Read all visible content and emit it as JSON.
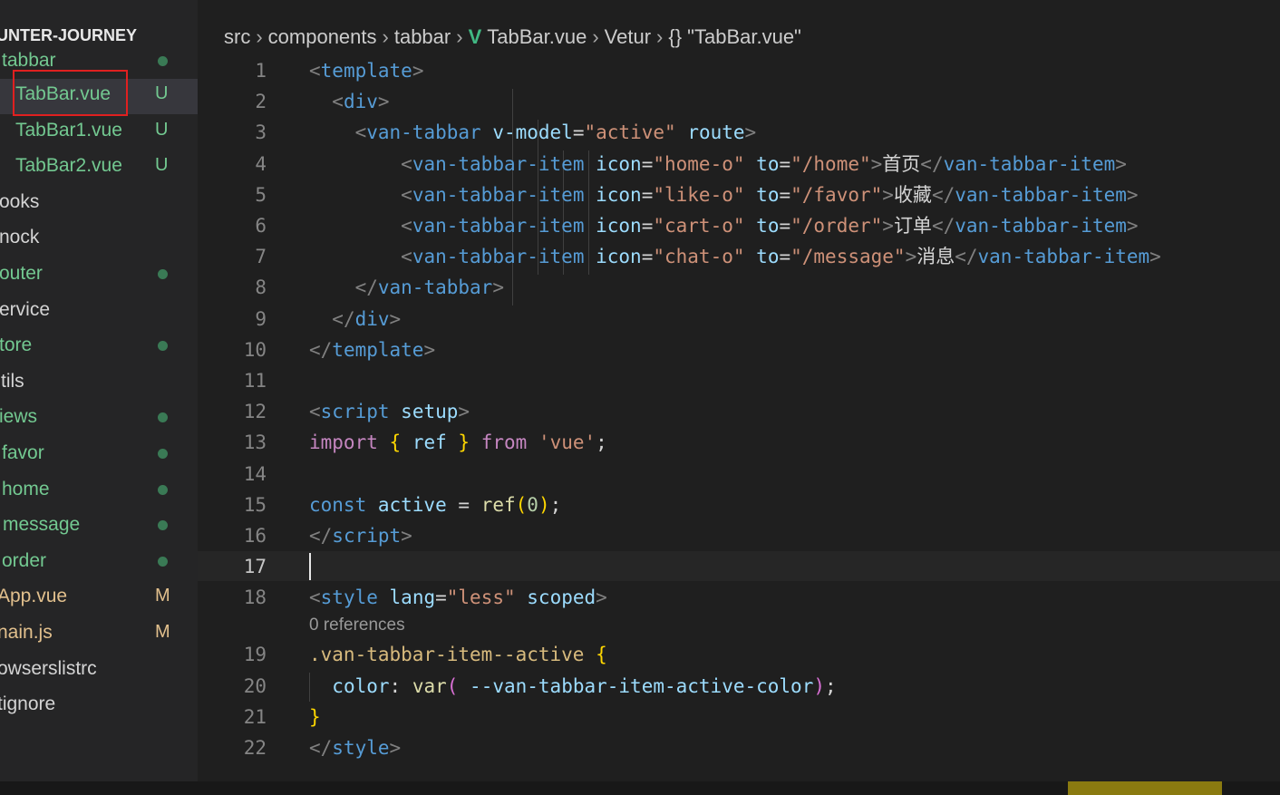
{
  "sidebar": {
    "header": "UNTER-JOURNEY",
    "items": [
      {
        "label": "tabbar",
        "status": "dot",
        "color": "green"
      },
      {
        "label": "TabBar.vue",
        "status": "U",
        "color": "green",
        "selected": true
      },
      {
        "label": "TabBar1.vue",
        "status": "U",
        "color": "green"
      },
      {
        "label": "TabBar2.vue",
        "status": "U",
        "color": "green"
      },
      {
        "label": "ooks",
        "status": "",
        "color": "white"
      },
      {
        "label": "nock",
        "status": "",
        "color": "white"
      },
      {
        "label": "outer",
        "status": "dot",
        "color": "green"
      },
      {
        "label": "ervice",
        "status": "",
        "color": "white"
      },
      {
        "label": "tore",
        "status": "dot",
        "color": "green"
      },
      {
        "label": "tils",
        "status": "",
        "color": "white"
      },
      {
        "label": "iews",
        "status": "dot",
        "color": "green"
      },
      {
        "label": "favor",
        "status": "dot",
        "color": "green"
      },
      {
        "label": "home",
        "status": "dot",
        "color": "green"
      },
      {
        "label": "message",
        "status": "dot",
        "color": "green"
      },
      {
        "label": "order",
        "status": "dot",
        "color": "green"
      },
      {
        "label": "App.vue",
        "status": "M",
        "color": "mod"
      },
      {
        "label": "nain.js",
        "status": "M",
        "color": "mod"
      },
      {
        "label": "owserslistrc",
        "status": "",
        "color": "white"
      },
      {
        "label": "tignore",
        "status": "",
        "color": "white"
      }
    ]
  },
  "breadcrumb": {
    "parts": [
      "src",
      "components",
      "tabbar"
    ],
    "file": "TabBar.vue",
    "extension": "Vetur",
    "symbol": "\"TabBar.vue\""
  },
  "editor": {
    "line_numbers": [
      "1",
      "2",
      "3",
      "4",
      "5",
      "6",
      "7",
      "8",
      "9",
      "10",
      "11",
      "12",
      "13",
      "14",
      "15",
      "16",
      "17",
      "18",
      "19",
      "20",
      "21",
      "22"
    ],
    "active_line": "17",
    "codelens": "0 references",
    "code": {
      "l1": {
        "a": "<",
        "b": "template",
        "c": ">"
      },
      "l2": {
        "a": "<",
        "b": "div",
        "c": ">"
      },
      "l3": {
        "a": "<",
        "b": "van-tabbar",
        "c": " ",
        "d": "v-model",
        "e": "=",
        "f": "\"active\"",
        "g": " ",
        "h": "route",
        "i": ">"
      },
      "l4": {
        "a": "<",
        "b": "van-tabbar-item",
        "c": " ",
        "d": "icon",
        "e": "=",
        "f": "\"home-o\"",
        "g": " ",
        "h": "to",
        "i": "=",
        "j": "\"/home\"",
        "k": ">",
        "l": "首页",
        "m": "</",
        "n": "van-tabbar-item",
        "o": ">"
      },
      "l5": {
        "a": "<",
        "b": "van-tabbar-item",
        "c": " ",
        "d": "icon",
        "e": "=",
        "f": "\"like-o\"",
        "g": " ",
        "h": "to",
        "i": "=",
        "j": "\"/favor\"",
        "k": ">",
        "l": "收藏",
        "m": "</",
        "n": "van-tabbar-item",
        "o": ">"
      },
      "l6": {
        "a": "<",
        "b": "van-tabbar-item",
        "c": " ",
        "d": "icon",
        "e": "=",
        "f": "\"cart-o\"",
        "g": " ",
        "h": "to",
        "i": "=",
        "j": "\"/order\"",
        "k": ">",
        "l": "订单",
        "m": "</",
        "n": "van-tabbar-item",
        "o": ">"
      },
      "l7": {
        "a": "<",
        "b": "van-tabbar-item",
        "c": " ",
        "d": "icon",
        "e": "=",
        "f": "\"chat-o\"",
        "g": " ",
        "h": "to",
        "i": "=",
        "j": "\"/message\"",
        "k": ">",
        "l": "消息",
        "m": "</",
        "n": "van-tabbar-item",
        "o": ">"
      },
      "l8": {
        "a": "</",
        "b": "van-tabbar",
        "c": ">"
      },
      "l9": {
        "a": "</",
        "b": "div",
        "c": ">"
      },
      "l10": {
        "a": "</",
        "b": "template",
        "c": ">"
      },
      "l12": {
        "a": "<",
        "b": "script",
        "c": " ",
        "d": "setup",
        "e": ">"
      },
      "l13": {
        "a": "import",
        "b": " ",
        "c": "{",
        "d": " ref ",
        "e": "}",
        "f": " ",
        "g": "from",
        "h": " ",
        "i": "'vue'",
        "j": ";"
      },
      "l15": {
        "a": "const",
        "b": " active ",
        "c": "=",
        "d": " ",
        "e": "ref",
        "f": "(",
        "g": "0",
        "h": ")",
        "i": ";"
      },
      "l16": {
        "a": "</",
        "b": "script",
        "c": ">"
      },
      "l18": {
        "a": "<",
        "b": "style",
        "c": " ",
        "d": "lang",
        "e": "=",
        "f": "\"less\"",
        "g": " ",
        "h": "scoped",
        "i": ">"
      },
      "l19": {
        "a": ".van-tabbar-item--active",
        "b": " ",
        "c": "{"
      },
      "l20": {
        "a": "color",
        "b": ": ",
        "c": "var",
        "d": "(",
        "e": " --van-tabbar-item-active-color",
        "f": ")",
        "g": ";"
      },
      "l21": {
        "a": "}"
      },
      "l22": {
        "a": "</",
        "b": "style",
        "c": ">"
      }
    }
  },
  "colors": {
    "background": "#1f1f1f",
    "sidebar": "#252526",
    "untracked": "#73c991",
    "modified": "#e2c08d",
    "highlight_box": "#e02020"
  }
}
